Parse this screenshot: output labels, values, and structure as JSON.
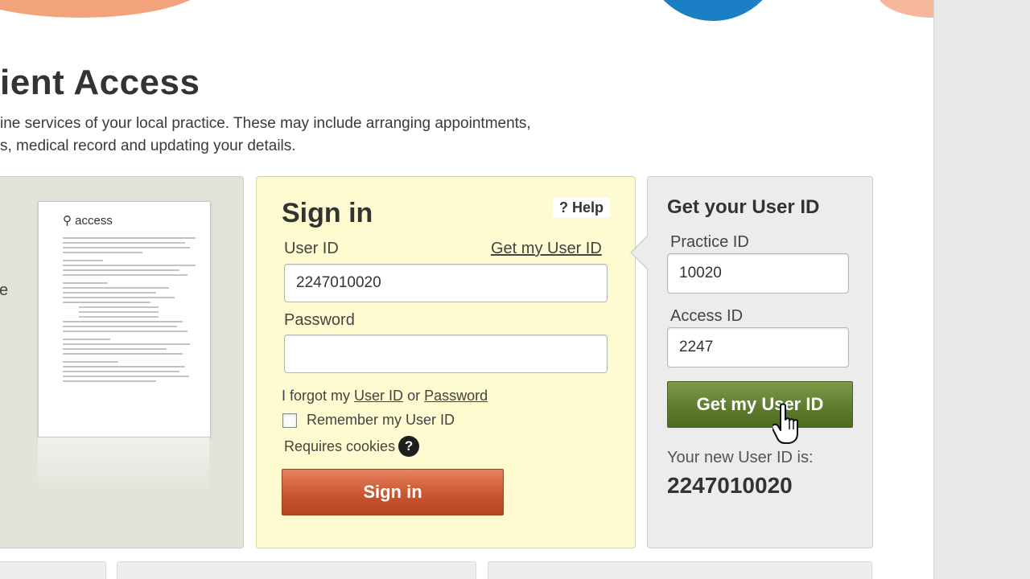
{
  "header": {
    "title": "ient Access",
    "intro_line1": "ine services of your local practice. These may include arranging appointments,",
    "intro_line2": "s, medical record and updating your details."
  },
  "left_panel": {
    "partial_letter": "e",
    "doc_logo": "access"
  },
  "sign_in": {
    "heading": "Sign in",
    "help_label": "Help",
    "user_id_label": "User ID",
    "get_user_id_link": "Get my User ID",
    "user_id_value": "2247010020",
    "password_label": "Password",
    "password_value": "",
    "forgot_prefix": "I forgot my",
    "forgot_user_id": "User ID",
    "forgot_or": "or",
    "forgot_password": "Password",
    "remember_label": "Remember my User ID",
    "cookies_label": "Requires cookies",
    "button_label": "Sign in"
  },
  "get_user_id": {
    "heading": "Get your User ID",
    "practice_id_label": "Practice ID",
    "practice_id_value": "10020",
    "access_id_label": "Access ID",
    "access_id_value": "2247",
    "button_label": "Get my User ID",
    "result_label": "Your new User ID is:",
    "result_value": "2247010020"
  },
  "icons": {
    "help": "question-mark",
    "cookies": "question-circle-icon",
    "cursor": "hand-pointer-icon"
  },
  "colors": {
    "sign_in_panel": "#fdfbcf",
    "sign_in_button": "#c5532e",
    "get_id_button": "#5c7a2c",
    "brand_blue": "#1a7fc4"
  }
}
